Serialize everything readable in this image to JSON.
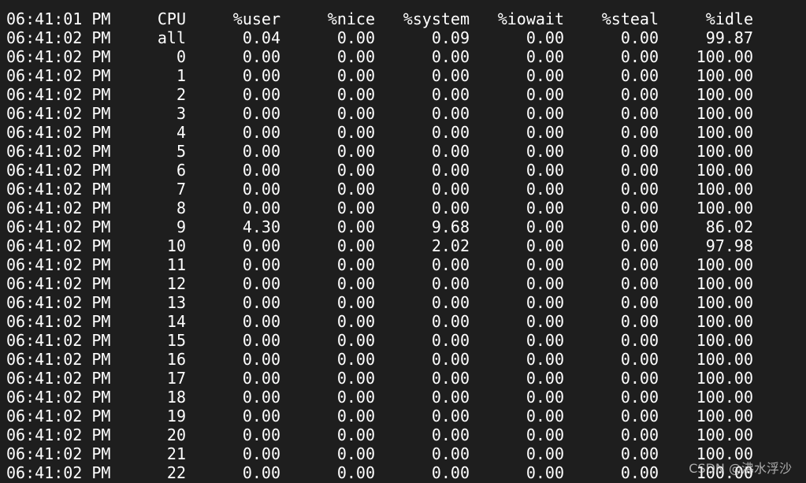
{
  "terminal": {
    "colors": {
      "background": "#1e1e1e",
      "text": "#ffffff"
    },
    "header": {
      "time": "06:41:01 PM",
      "cpu": "CPU",
      "user": "%user",
      "nice": "%nice",
      "system": "%system",
      "iowait": "%iowait",
      "steal": "%steal",
      "idle": "%idle"
    },
    "rows": [
      {
        "time": "06:41:02 PM",
        "cpu": "all",
        "user": "0.04",
        "nice": "0.00",
        "system": "0.09",
        "iowait": "0.00",
        "steal": "0.00",
        "idle": "99.87"
      },
      {
        "time": "06:41:02 PM",
        "cpu": "0",
        "user": "0.00",
        "nice": "0.00",
        "system": "0.00",
        "iowait": "0.00",
        "steal": "0.00",
        "idle": "100.00"
      },
      {
        "time": "06:41:02 PM",
        "cpu": "1",
        "user": "0.00",
        "nice": "0.00",
        "system": "0.00",
        "iowait": "0.00",
        "steal": "0.00",
        "idle": "100.00"
      },
      {
        "time": "06:41:02 PM",
        "cpu": "2",
        "user": "0.00",
        "nice": "0.00",
        "system": "0.00",
        "iowait": "0.00",
        "steal": "0.00",
        "idle": "100.00"
      },
      {
        "time": "06:41:02 PM",
        "cpu": "3",
        "user": "0.00",
        "nice": "0.00",
        "system": "0.00",
        "iowait": "0.00",
        "steal": "0.00",
        "idle": "100.00"
      },
      {
        "time": "06:41:02 PM",
        "cpu": "4",
        "user": "0.00",
        "nice": "0.00",
        "system": "0.00",
        "iowait": "0.00",
        "steal": "0.00",
        "idle": "100.00"
      },
      {
        "time": "06:41:02 PM",
        "cpu": "5",
        "user": "0.00",
        "nice": "0.00",
        "system": "0.00",
        "iowait": "0.00",
        "steal": "0.00",
        "idle": "100.00"
      },
      {
        "time": "06:41:02 PM",
        "cpu": "6",
        "user": "0.00",
        "nice": "0.00",
        "system": "0.00",
        "iowait": "0.00",
        "steal": "0.00",
        "idle": "100.00"
      },
      {
        "time": "06:41:02 PM",
        "cpu": "7",
        "user": "0.00",
        "nice": "0.00",
        "system": "0.00",
        "iowait": "0.00",
        "steal": "0.00",
        "idle": "100.00"
      },
      {
        "time": "06:41:02 PM",
        "cpu": "8",
        "user": "0.00",
        "nice": "0.00",
        "system": "0.00",
        "iowait": "0.00",
        "steal": "0.00",
        "idle": "100.00"
      },
      {
        "time": "06:41:02 PM",
        "cpu": "9",
        "user": "4.30",
        "nice": "0.00",
        "system": "9.68",
        "iowait": "0.00",
        "steal": "0.00",
        "idle": "86.02"
      },
      {
        "time": "06:41:02 PM",
        "cpu": "10",
        "user": "0.00",
        "nice": "0.00",
        "system": "2.02",
        "iowait": "0.00",
        "steal": "0.00",
        "idle": "97.98"
      },
      {
        "time": "06:41:02 PM",
        "cpu": "11",
        "user": "0.00",
        "nice": "0.00",
        "system": "0.00",
        "iowait": "0.00",
        "steal": "0.00",
        "idle": "100.00"
      },
      {
        "time": "06:41:02 PM",
        "cpu": "12",
        "user": "0.00",
        "nice": "0.00",
        "system": "0.00",
        "iowait": "0.00",
        "steal": "0.00",
        "idle": "100.00"
      },
      {
        "time": "06:41:02 PM",
        "cpu": "13",
        "user": "0.00",
        "nice": "0.00",
        "system": "0.00",
        "iowait": "0.00",
        "steal": "0.00",
        "idle": "100.00"
      },
      {
        "time": "06:41:02 PM",
        "cpu": "14",
        "user": "0.00",
        "nice": "0.00",
        "system": "0.00",
        "iowait": "0.00",
        "steal": "0.00",
        "idle": "100.00"
      },
      {
        "time": "06:41:02 PM",
        "cpu": "15",
        "user": "0.00",
        "nice": "0.00",
        "system": "0.00",
        "iowait": "0.00",
        "steal": "0.00",
        "idle": "100.00"
      },
      {
        "time": "06:41:02 PM",
        "cpu": "16",
        "user": "0.00",
        "nice": "0.00",
        "system": "0.00",
        "iowait": "0.00",
        "steal": "0.00",
        "idle": "100.00"
      },
      {
        "time": "06:41:02 PM",
        "cpu": "17",
        "user": "0.00",
        "nice": "0.00",
        "system": "0.00",
        "iowait": "0.00",
        "steal": "0.00",
        "idle": "100.00"
      },
      {
        "time": "06:41:02 PM",
        "cpu": "18",
        "user": "0.00",
        "nice": "0.00",
        "system": "0.00",
        "iowait": "0.00",
        "steal": "0.00",
        "idle": "100.00"
      },
      {
        "time": "06:41:02 PM",
        "cpu": "19",
        "user": "0.00",
        "nice": "0.00",
        "system": "0.00",
        "iowait": "0.00",
        "steal": "0.00",
        "idle": "100.00"
      },
      {
        "time": "06:41:02 PM",
        "cpu": "20",
        "user": "0.00",
        "nice": "0.00",
        "system": "0.00",
        "iowait": "0.00",
        "steal": "0.00",
        "idle": "100.00"
      },
      {
        "time": "06:41:02 PM",
        "cpu": "21",
        "user": "0.00",
        "nice": "0.00",
        "system": "0.00",
        "iowait": "0.00",
        "steal": "0.00",
        "idle": "100.00"
      },
      {
        "time": "06:41:02 PM",
        "cpu": "22",
        "user": "0.00",
        "nice": "0.00",
        "system": "0.00",
        "iowait": "0.00",
        "steal": "0.00",
        "idle": "100.00"
      }
    ]
  },
  "watermark": {
    "text": "CSDN @沸水浮沙"
  }
}
